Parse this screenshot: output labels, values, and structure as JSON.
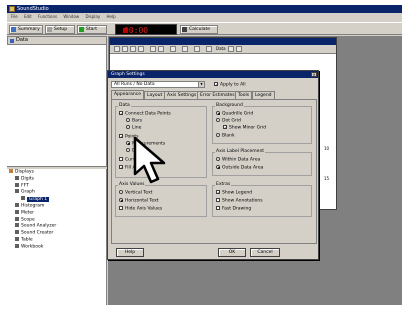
{
  "app": {
    "title": "SoundStudio"
  },
  "menu": [
    "File",
    "Edit",
    "Functions",
    "Window",
    "Display",
    "Help"
  ],
  "toolbar": {
    "summary": "Summary",
    "setup": "Setup",
    "start": "Start",
    "clock": "00:00",
    "calculate": "Calculate"
  },
  "data_panel": {
    "title": "Data"
  },
  "tree": [
    {
      "label": "Displays",
      "level": 0
    },
    {
      "label": "Digits",
      "level": 1
    },
    {
      "label": "FFT",
      "level": 1
    },
    {
      "label": "Graph",
      "level": 1
    },
    {
      "label": "Graph 1",
      "level": 2,
      "selected": true
    },
    {
      "label": "Histogram",
      "level": 1
    },
    {
      "label": "Meter",
      "level": 1
    },
    {
      "label": "Scope",
      "level": 1
    },
    {
      "label": "Sound Analyzer",
      "level": 1
    },
    {
      "label": "Sound Creator",
      "level": 1
    },
    {
      "label": "Table",
      "level": 1
    },
    {
      "label": "Workbook",
      "level": 1
    }
  ],
  "graph_toolbar": {
    "data_label": "Data"
  },
  "graph_side_numbers": [
    "10",
    "15"
  ],
  "dialog": {
    "title": "Graph Settings",
    "run_select": "All Runs / No Data",
    "apply_all": "Apply to All",
    "tabs": [
      "Appearance",
      "Layout",
      "Axis Settings",
      "Error Estimates",
      "Tools",
      "Legend"
    ],
    "data_group": {
      "label": "Data",
      "options": [
        {
          "label": "Connect Data Points",
          "checked": true
        },
        {
          "label": "Bars",
          "checked": false
        },
        {
          "label": "Line",
          "checked": false
        },
        {
          "label": "Points",
          "checked": true
        },
        {
          "label": "Measurements",
          "checked": true
        },
        {
          "label": "Dots",
          "checked": false
        },
        {
          "label": "Curve Fit",
          "checked": false
        },
        {
          "label": "Fill Area",
          "checked": true
        }
      ]
    },
    "background_group": {
      "label": "Background",
      "options": [
        {
          "label": "Quadrille Grid",
          "checked": true
        },
        {
          "label": "Dot Grid",
          "checked": false
        },
        {
          "label": "Show Minor Grid",
          "checked": true
        },
        {
          "label": "Blank",
          "checked": false
        }
      ]
    },
    "axis_label_group": {
      "label": "Axis Label Placement",
      "options": [
        {
          "label": "Within Data Area",
          "checked": false
        },
        {
          "label": "Outside Data Area",
          "checked": true
        }
      ]
    },
    "axis_values_group": {
      "label": "Axis Values",
      "options": [
        {
          "label": "Vertical Text",
          "checked": false
        },
        {
          "label": "Horizontal Text",
          "checked": true
        },
        {
          "label": "Hide Axis Values",
          "checked": false
        }
      ]
    },
    "extras_group": {
      "label": "Extras",
      "options": [
        {
          "label": "Show Legend",
          "checked": true
        },
        {
          "label": "Show Annotations",
          "checked": false
        },
        {
          "label": "Fast Drawing",
          "checked": false
        }
      ]
    },
    "buttons": {
      "help": "Help",
      "ok": "OK",
      "cancel": "Cancel"
    }
  },
  "colors": {
    "titlebar": "#0a246a",
    "face": "#d4d0c8",
    "workspace": "#808080",
    "clock_text": "#e02020"
  }
}
